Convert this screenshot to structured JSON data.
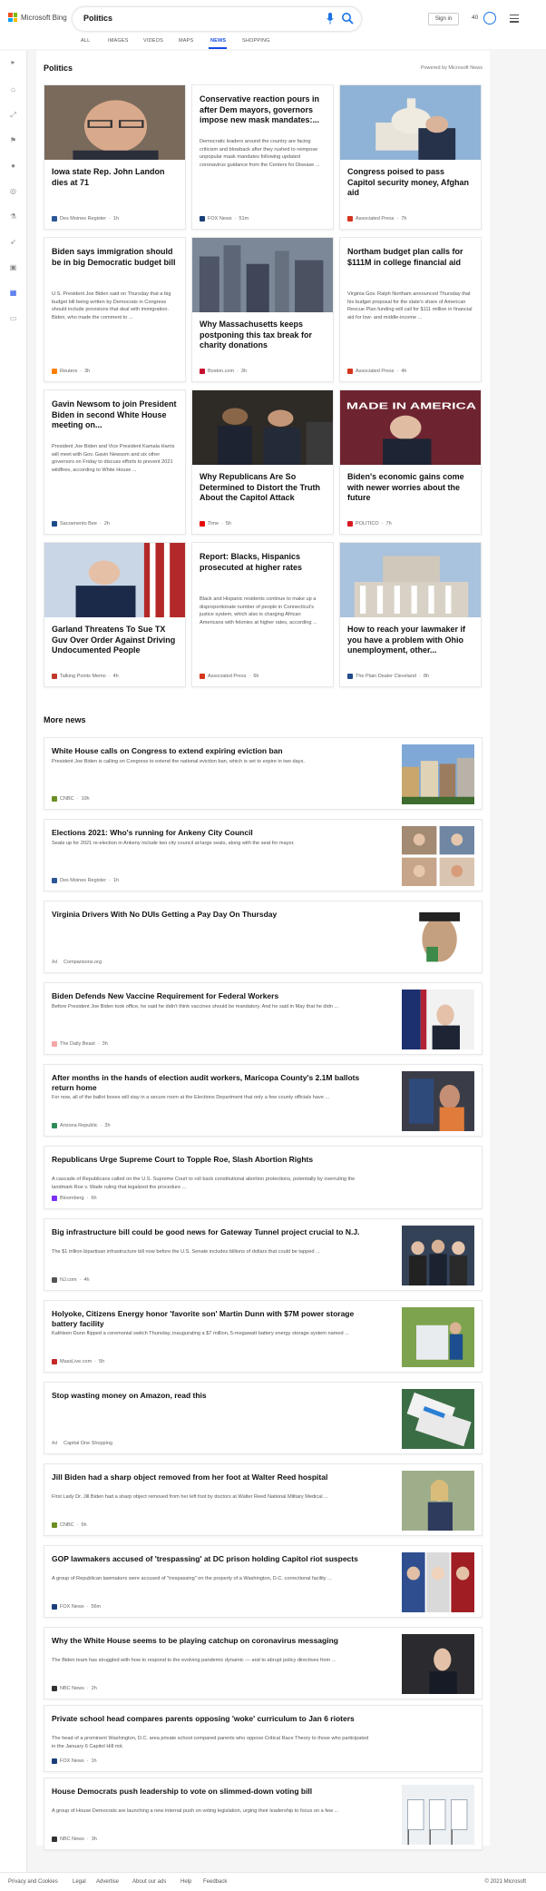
{
  "header": {
    "brand": "Microsoft Bing",
    "query": "Politics",
    "sign_in": "Sign in",
    "points": "40",
    "tabs": [
      "ALL",
      "IMAGES",
      "VIDEOS",
      "MAPS",
      "NEWS",
      "SHOPPING"
    ],
    "active_tab": "NEWS",
    "accent": "#174ae4"
  },
  "sidebar": {
    "icons": [
      "chevron-right-icon",
      "home-icon",
      "grid-icon",
      "flag-icon",
      "pin-icon",
      "globe-icon",
      "stats-icon",
      "rocket-icon",
      "film-icon",
      "building-icon",
      "wallet-icon"
    ]
  },
  "politics": {
    "title": "Politics",
    "powered_by": "Powered by Microsoft News",
    "cards": [
      {
        "title": "Iowa state Rep. John Landon dies at 71",
        "desc": "",
        "source": "Des Moines Register",
        "age": "1h",
        "fav": "#2b5797",
        "img": "portrait"
      },
      {
        "title": "Conservative reaction pours in after Dem mayors, governors impose new mask mandates:...",
        "desc": "Democratic leaders around the country are facing criticism and blowback after they rushed to reimpose unpopular mask mandates following updated coronavirus guidance from the Centers for Disease ...",
        "source": "FOX News",
        "age": "51m",
        "fav": "#1b3f7a",
        "img": ""
      },
      {
        "title": "Congress poised to pass Capitol security money, Afghan aid",
        "desc": "",
        "source": "Associated Press",
        "age": "7h",
        "fav": "#d4351c",
        "img": "capitol"
      },
      {
        "title": "Biden says immigration should be in big Democratic budget bill",
        "desc": "U.S. President Joe Biden said on Thursday that a big budget bill being written by Democrats in Congress should include provisions that deal with immigration. Biden, who made the comment to ...",
        "source": "Reuters",
        "age": "3h",
        "fav": "#ff8000",
        "img": ""
      },
      {
        "title": "Why Massachusetts keeps postponing this tax break for charity donations",
        "desc": "",
        "source": "Boston.com",
        "age": "3h",
        "fav": "#c8102e",
        "img": "city"
      },
      {
        "title": "Northam budget plan calls for $111M in college financial aid",
        "desc": "Virginia Gov. Ralph Northam announced Thursday that his budget proposal for the state's share of American Rescue Plan funding will call for $111 million in financial aid for low- and middle-income ...",
        "source": "Associated Press",
        "age": "4h",
        "fav": "#d4351c",
        "img": ""
      },
      {
        "title": "Gavin Newsom to join President Biden in second White House meeting on...",
        "desc": "President Joe Biden and Vice President Kamala Harris will meet with Gov. Gavin Newsom and six other governors on Friday to discuss efforts to prevent 2021 wildfires, according to White House ...",
        "source": "Sacramento Bee",
        "age": "2h",
        "fav": "#1a4a8a",
        "img": ""
      },
      {
        "title": "Why Republicans Are So Determined to Distort the Truth About the Capitol Attack",
        "desc": "",
        "source": "Time",
        "age": "5h",
        "fav": "#e90606",
        "img": "police"
      },
      {
        "title": "Biden's economic gains come with newer worries about the future",
        "desc": "",
        "source": "POLITICO",
        "age": "7h",
        "fav": "#d71920",
        "img": "biden"
      },
      {
        "title": "Garland Threatens To Sue TX Guv Over Order Against Driving Undocumented People",
        "desc": "",
        "source": "Talking Points Memo",
        "age": "4h",
        "fav": "#c0392b",
        "img": "speaker"
      },
      {
        "title": "Report: Blacks, Hispanics prosecuted at higher rates",
        "desc": "Black and Hispanic residents continue to make up a disproportionate number of people in Connecticut's justice system, which also is charging African Americans with felonies at higher rates, according ...",
        "source": "Associated Press",
        "age": "6h",
        "fav": "#d4351c",
        "img": ""
      },
      {
        "title": "How to reach your lawmaker if you have a problem with Ohio unemployment, other...",
        "desc": "",
        "source": "The Plain Dealer Cleveland",
        "age": "8h",
        "fav": "#234b8c",
        "img": "statehouse"
      }
    ]
  },
  "more_news": {
    "title": "More news",
    "items": [
      {
        "title": "White House calls on Congress to extend expiring eviction ban",
        "desc": "President Joe Biden is calling on Congress to extend the national eviction ban, which is set to expire in two days.",
        "source": "CNBC",
        "age": "10h",
        "ad": "",
        "fav": "#6b8e23",
        "img": "houses"
      },
      {
        "title": "Elections 2021: Who's running for Ankeny City Council",
        "desc": "Seats up for 2021 re-election in Ankeny include two city council at-large seats, along with the seat for mayor.",
        "source": "Des Moines Register",
        "age": "1h",
        "ad": "",
        "fav": "#2b5797",
        "img": "collage"
      },
      {
        "title": "Virginia Drivers With No DUIs Getting a Pay Day On Thursday",
        "desc": "",
        "source": "Comparisons.org",
        "age": "",
        "ad": "Ad",
        "fav": "",
        "img": "manhat"
      },
      {
        "title": "Biden Defends New Vaccine Requirement for Federal Workers",
        "desc": "Before President Joe Biden took office, he said he didn't think vaccines should be mandatory. And he said in May that he didn ...",
        "source": "The Daily Beast",
        "age": "3h",
        "ad": "",
        "fav": "#f4a6a6",
        "img": "bidenflag"
      },
      {
        "title": "After months in the hands of election audit workers, Maricopa County's 2.1M ballots return home",
        "desc": "For now, all of the ballot boxes will stay in a secure room at the Elections Department that only a few county officials have ...",
        "source": "Arizona Republic",
        "age": "3h",
        "ad": "",
        "fav": "#2e8b57",
        "img": "ballots"
      },
      {
        "title": "Republicans Urge Supreme Court to Topple Roe, Slash Abortion Rights",
        "desc": "A cascade of Republicans called on the U.S. Supreme Court to roll back constitutional abortion protections, potentially by overruling the landmark Roe v. Wade ruling that legalized the procedure ...",
        "source": "Bloomberg",
        "age": "6h",
        "ad": "",
        "fav": "#7b2ff7",
        "img": ""
      },
      {
        "title": "Big infrastructure bill could be good news for Gateway Tunnel project crucial to N.J.",
        "desc": "The $1 trillion bipartisan infrastructure bill now before the U.S. Senate includes billions of dollars that could be tapped ...",
        "source": "NJ.com",
        "age": "4h",
        "ad": "",
        "fav": "#555555",
        "img": "senators"
      },
      {
        "title": "Holyoke, Citizens Energy honor 'favorite son' Martin Dunn with $7M power storage battery facility",
        "desc": "Kathleen Dunn flipped a ceremonial switch Thursday, inaugurating a $7 million, 5-megawatt battery energy storage system named ...",
        "source": "MassLive.com",
        "age": "5h",
        "ad": "",
        "fav": "#c62828",
        "img": "battery"
      },
      {
        "title": "Stop wasting money on Amazon, read this",
        "desc": "",
        "source": "Capital One Shopping",
        "age": "",
        "ad": "Ad",
        "fav": "",
        "img": "boxes"
      },
      {
        "title": "Jill Biden had a sharp object removed from her foot at Walter Reed hospital",
        "desc": "First Lady Dr. Jill Biden had a sharp object removed from her left foot by doctors at Walter Reed National Military Medical ...",
        "source": "CNBC",
        "age": "5h",
        "ad": "",
        "fav": "#6b8e23",
        "img": "jill"
      },
      {
        "title": "GOP lawmakers accused of 'trespassing' at DC prison holding Capitol riot suspects",
        "desc": "A group of Republican lawmakers were accused of \"trespassing\" on the property of a Washington, D.C. correctional facility ...",
        "source": "FOX News",
        "age": "56m",
        "ad": "",
        "fav": "#1b3f7a",
        "img": "trio"
      },
      {
        "title": "Why the White House seems to be playing catchup on coronavirus messaging",
        "desc": "The Biden team has struggled with how to respond to the evolving pandemic dynamic — and to abrupt policy directives from ...",
        "source": "NBC News",
        "age": "2h",
        "ad": "",
        "fav": "#333333",
        "img": "bidendark"
      },
      {
        "title": "Private school head compares parents opposing 'woke' curriculum to Jan 6 rioters",
        "desc": "The head of a prominent Washington, D.C. area private school compared parents who oppose Critical Race Theory to those who participated in the January 6 Capitol Hill riot.",
        "source": "FOX News",
        "age": "1h",
        "ad": "",
        "fav": "#1b3f7a",
        "img": ""
      },
      {
        "title": "House Democrats push leadership to vote on slimmed-down voting bill",
        "desc": "A group of House Democrats are launching a new internal push on voting legislation, urging their leadership to focus on a few ...",
        "source": "NBC News",
        "age": "3h",
        "ad": "",
        "fav": "#333333",
        "img": "booths"
      }
    ]
  },
  "footer": {
    "links": [
      "Privacy and Cookies",
      "Legal",
      "Advertise",
      "About our ads",
      "Help",
      "Feedback"
    ],
    "copyright": "© 2021 Microsoft"
  }
}
